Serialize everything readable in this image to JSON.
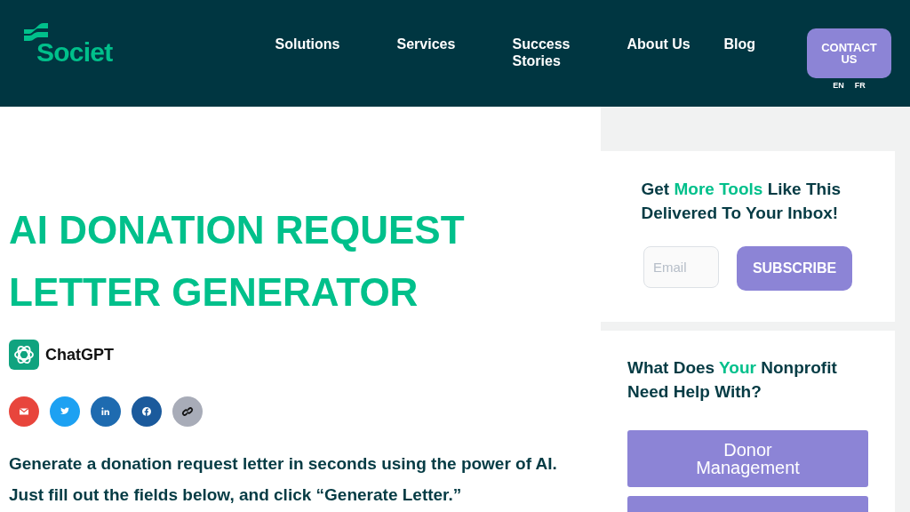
{
  "header": {
    "logo": "Societ",
    "nav": [
      "Solutions",
      "Services",
      "Success Stories",
      "About Us",
      "Blog"
    ],
    "contact_button": "CONTACT US",
    "languages": [
      "EN",
      "FR"
    ]
  },
  "main": {
    "title_lines": [
      "AI DONATION REQUEST",
      "LETTER GENERATOR"
    ],
    "tool": "ChatGPT",
    "share": [
      {
        "kind": "email",
        "color": "#e8453c"
      },
      {
        "kind": "twitter",
        "color": "#1da1f2"
      },
      {
        "kind": "linkedin",
        "color": "#1e6bb0"
      },
      {
        "kind": "facebook",
        "color": "#1b5a9c"
      },
      {
        "kind": "link",
        "color": "#a8acb8"
      }
    ],
    "intro_lines": [
      "Generate a donation request letter in seconds using the power of AI.",
      "Just fill out the fields below, and click “Generate Letter.”"
    ]
  },
  "newsletter": {
    "heading": [
      {
        "text": "Get ",
        "highlight": false
      },
      {
        "text": "More Tools",
        "highlight": true
      },
      {
        "text": " Like This Delivered To Your Inbox!",
        "highlight": false
      }
    ],
    "placeholder": "Email",
    "button": "SUBSCRIBE"
  },
  "help": {
    "heading": [
      {
        "text": "What Does ",
        "highlight": false
      },
      {
        "text": "Your",
        "highlight": true
      },
      {
        "text": " Nonprofit Need Help With?",
        "highlight": false
      }
    ],
    "options": [
      "Donor Management"
    ],
    "more_options_cut": true
  }
}
